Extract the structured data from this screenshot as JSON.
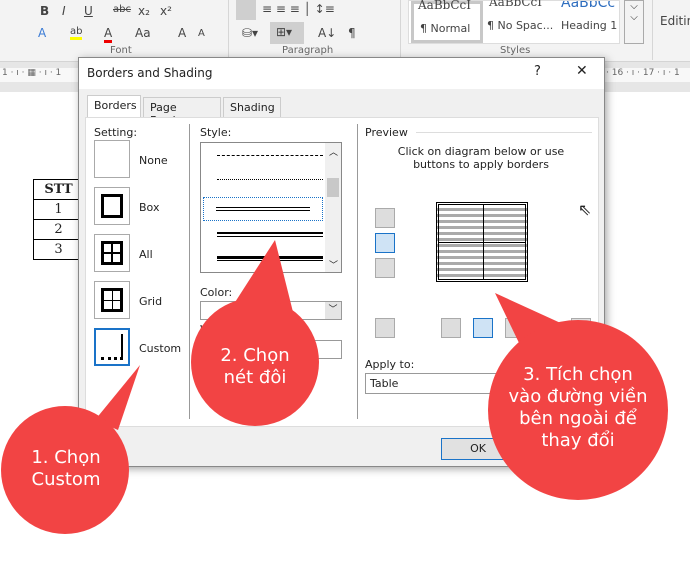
{
  "ribbon": {
    "font_buttons": [
      "B",
      "I",
      "U",
      "abc",
      "x₂",
      "x²"
    ],
    "font_row2": [
      "A",
      "ab",
      "A",
      "Aa",
      "A",
      "A"
    ],
    "styles": [
      {
        "preview": "AaBbCcI",
        "label": "¶ Normal"
      },
      {
        "preview": "AaBbCcI",
        "label": "¶ No Spac..."
      },
      {
        "preview": "AaBbCc",
        "label": "Heading 1"
      }
    ],
    "editing": "Editing",
    "groups": [
      "Font",
      "Paragraph",
      "Styles"
    ]
  },
  "ruler": {
    "left": "1 · ı · ▦   · ı · 1",
    "right": "· 16 · ı · 17 · ı · 1"
  },
  "document": {
    "table": {
      "header": "STT",
      "rows": [
        "1",
        "2",
        "3"
      ]
    }
  },
  "dialog": {
    "title": "Borders and Shading",
    "help": "?",
    "close": "✕",
    "tabs": [
      "Borders",
      "Page Border",
      "Shading"
    ],
    "active_tab": "Borders",
    "setting_label": "Setting:",
    "settings": [
      "None",
      "Box",
      "All",
      "Grid",
      "Custom"
    ],
    "selected_setting": "Custom",
    "style_label": "Style:",
    "color_label": "Color:",
    "width_label": "W",
    "preview_label": "Preview",
    "preview_hint": "Click on diagram below or use buttons to apply borders",
    "apply_to_label": "Apply to:",
    "apply_to_value": "Table",
    "ok": "OK",
    "accent": "#1a73c8"
  },
  "callouts": [
    {
      "text": "1. Chọn Custom",
      "color": "#f24444"
    },
    {
      "text": "2. Chọn nét đôi",
      "color": "#f24444"
    },
    {
      "text": "3. Tích chọn vào đường viền bên ngoài để thay đổi",
      "color": "#f24444"
    }
  ]
}
